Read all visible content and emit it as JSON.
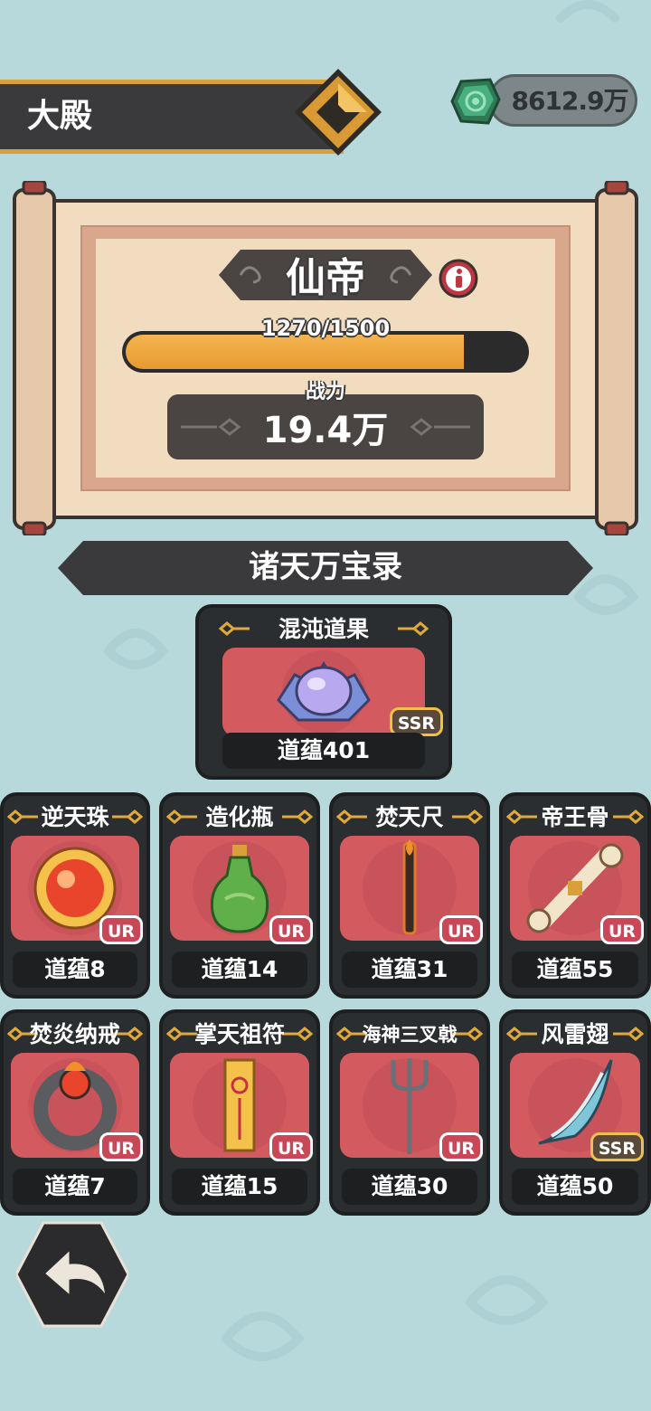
{
  "header": {
    "title": "大殿"
  },
  "currency": {
    "value": "8612.9万",
    "icon": "jade-gem-icon"
  },
  "rank": {
    "title": "仙帝",
    "progress_text": "1270/1500",
    "progress_fraction": 0.8467,
    "power_label": "战力",
    "power_value": "19.4万"
  },
  "section": {
    "title": "诸天万宝录"
  },
  "featured": {
    "name": "混沌道果",
    "rarity": "SSR",
    "footer": "道蕴401",
    "icon": "chaos-fruit-icon"
  },
  "treasures": [
    {
      "name": "逆天珠",
      "rarity": "UR",
      "footer": "道蕴8",
      "icon": "fire-orb-icon"
    },
    {
      "name": "造化瓶",
      "rarity": "UR",
      "footer": "道蕴14",
      "icon": "green-vase-icon"
    },
    {
      "name": "焚天尺",
      "rarity": "UR",
      "footer": "道蕴31",
      "icon": "flame-ruler-icon"
    },
    {
      "name": "帝王骨",
      "rarity": "UR",
      "footer": "道蕴55",
      "icon": "emperor-bone-icon"
    },
    {
      "name": "焚炎纳戒",
      "rarity": "UR",
      "footer": "道蕴7",
      "icon": "flame-ring-icon"
    },
    {
      "name": "掌天祖符",
      "rarity": "UR",
      "footer": "道蕴15",
      "icon": "talisman-icon"
    },
    {
      "name": "海神三叉戟",
      "rarity": "UR",
      "footer": "道蕴30",
      "icon": "trident-icon"
    },
    {
      "name": "风雷翅",
      "rarity": "SSR",
      "footer": "道蕴50",
      "icon": "thunder-wing-icon"
    }
  ],
  "colors": {
    "background": "#b8d9dc",
    "card_art": "#d35a5f",
    "accent_gold": "#d9a03a",
    "ur_badge": "#c94756"
  }
}
